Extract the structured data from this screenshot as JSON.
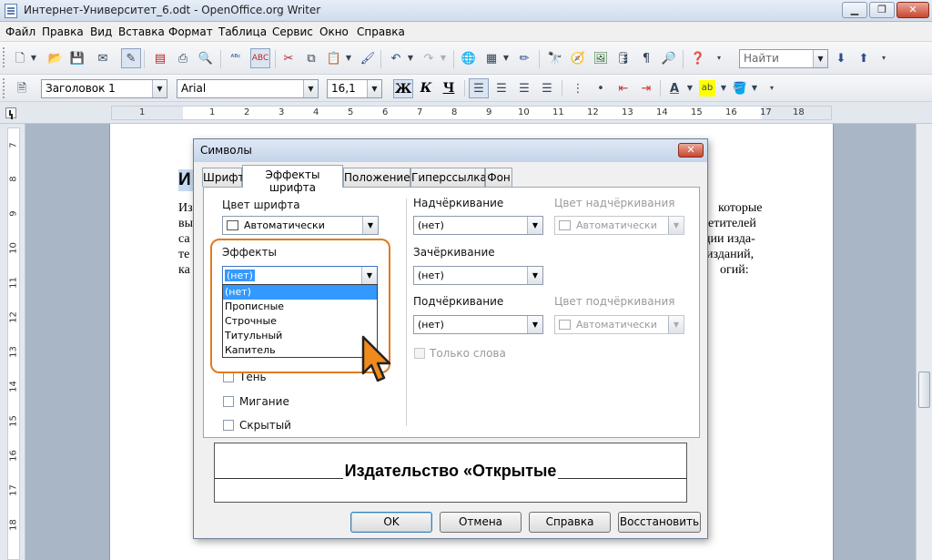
{
  "window": {
    "title": "Интернет-Университет_6.odt - OpenOffice.org Writer",
    "minimize": "▁",
    "maximize": "❐",
    "close": "✕"
  },
  "menu": [
    "Файл",
    "Правка",
    "Вид",
    "Вставка",
    "Формат",
    "Таблица",
    "Сервис",
    "Окно",
    "Справка"
  ],
  "toolbar": {
    "find_placeholder": "Найти",
    "style_value": "Заголовок 1",
    "font_value": "Arial",
    "size_value": "16,1",
    "bold": "Ж",
    "italic": "К",
    "underline": "Ч"
  },
  "ruler": {
    "h_numbers": [
      "1",
      "1",
      "2",
      "3",
      "4",
      "5",
      "6",
      "7",
      "8",
      "9",
      "10",
      "11",
      "12",
      "13",
      "14",
      "15",
      "16",
      "17",
      "18"
    ],
    "v_numbers": [
      "7",
      "8",
      "9",
      "10",
      "11",
      "12",
      "13",
      "14",
      "15",
      "16",
      "17",
      "18"
    ]
  },
  "document": {
    "heading_fragment": "И",
    "left_lines": [
      "Из",
      "вы",
      "са",
      "те",
      "ка"
    ],
    "right_lines": [
      "которые",
      "етителей",
      "ции изда-",
      "изданий,",
      "огий:"
    ]
  },
  "dialog": {
    "title": "Символы",
    "close": "✕",
    "tabs": [
      "Шрифт",
      "Эффекты шрифта",
      "Положение",
      "Гиперссылка",
      "Фон"
    ],
    "active_tab": "Эффекты шрифта",
    "font_color": {
      "label": "Цвет шрифта",
      "value": "Автоматически"
    },
    "effects": {
      "label": "Эффекты",
      "value": "(нет)",
      "options": [
        "(нет)",
        "Прописные",
        "Строчные",
        "Титульный",
        "Капитель"
      ],
      "selected": "(нет)"
    },
    "checkboxes": [
      {
        "label": "Тень",
        "checked": false
      },
      {
        "label": "Мигание",
        "checked": false
      },
      {
        "label": "Скрытый",
        "checked": false
      }
    ],
    "overline": {
      "label": "Надчёркивание",
      "value": "(нет)",
      "color_label": "Цвет надчёркивания",
      "color_value": "Автоматически"
    },
    "strikethrough": {
      "label": "Зачёркивание",
      "value": "(нет)"
    },
    "underline": {
      "label": "Подчёркивание",
      "value": "(нет)",
      "color_label": "Цвет подчёркивания",
      "color_value": "Автоматически"
    },
    "words_only": "Только слова",
    "preview_text": "Издательство «Открытые",
    "buttons": {
      "ok": "OK",
      "cancel": "Отмена",
      "help": "Справка",
      "reset": "Восстановить"
    }
  },
  "colors": {
    "highlight": "#e07b1f",
    "selection": "#3399ff"
  }
}
